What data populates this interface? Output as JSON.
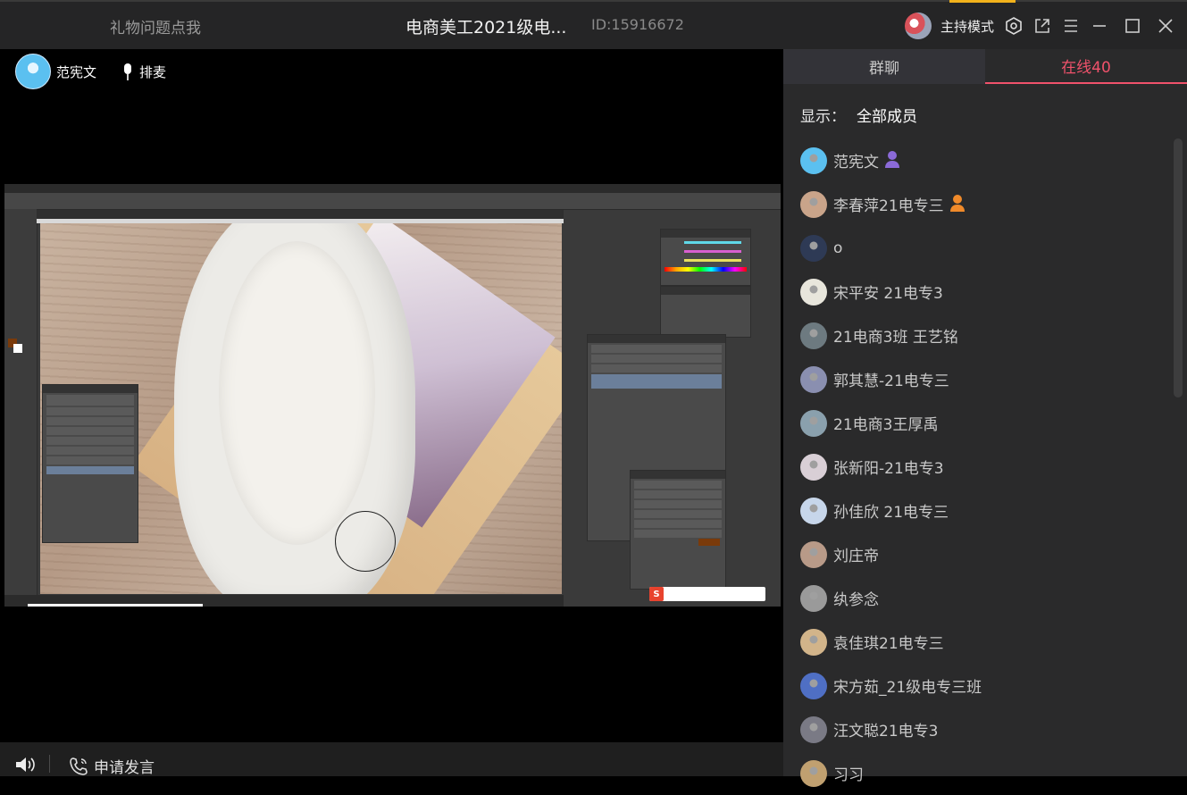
{
  "topbar": {
    "gift_link": "礼物问题点我",
    "room_title": "电商美工2021级电...",
    "room_id": "ID:15916672",
    "host_mode": "主持模式",
    "icons": [
      "settings-hex-icon",
      "popout-icon",
      "menu-icon",
      "minimize-icon",
      "maximize-icon",
      "close-icon"
    ]
  },
  "presenter": {
    "name": "范宪文",
    "mic_queue": "排麦"
  },
  "bottom": {
    "apply_speak": "申请发言"
  },
  "side": {
    "tabs": [
      {
        "label": "群聊",
        "active": false
      },
      {
        "label": "在线40",
        "active": true
      }
    ],
    "filter_label": "显示：",
    "filter_value": "全部成员",
    "members": [
      {
        "name": "范宪文",
        "color": "#5bc0f0",
        "badge": "host"
      },
      {
        "name": "李春萍21电专三",
        "color": "#c9a48a",
        "badge": "assistant"
      },
      {
        "name": "o",
        "color": "#2e3a55",
        "badge": ""
      },
      {
        "name": "宋平安 21电专3",
        "color": "#e8e6dc",
        "badge": ""
      },
      {
        "name": "21电商3班 王艺铭",
        "color": "#6d7a80",
        "badge": ""
      },
      {
        "name": "郭其慧-21电专三",
        "color": "#8a8fb0",
        "badge": ""
      },
      {
        "name": "21电商3王厚禹",
        "color": "#8aa0ad",
        "badge": ""
      },
      {
        "name": "张新阳-21电专3",
        "color": "#d9cfd6",
        "badge": ""
      },
      {
        "name": "孙佳欣 21电专三",
        "color": "#c7d6ea",
        "badge": ""
      },
      {
        "name": "刘庄帝",
        "color": "#b89a88",
        "badge": ""
      },
      {
        "name": "纨参念",
        "color": "#9a9a9a",
        "badge": ""
      },
      {
        "name": "袁佳琪21电专三",
        "color": "#d2b48a",
        "badge": ""
      },
      {
        "name": "宋方茹_21级电专三班",
        "color": "#4f6fc4",
        "badge": ""
      },
      {
        "name": "汪文聪21电专3",
        "color": "#7a7a85",
        "badge": ""
      },
      {
        "name": "习习",
        "color": "#c0a070",
        "badge": ""
      }
    ]
  },
  "colors": {
    "accent_pink": "#f0526b",
    "panel_bg": "#2a2a2b",
    "topbar_bg": "#252526"
  }
}
